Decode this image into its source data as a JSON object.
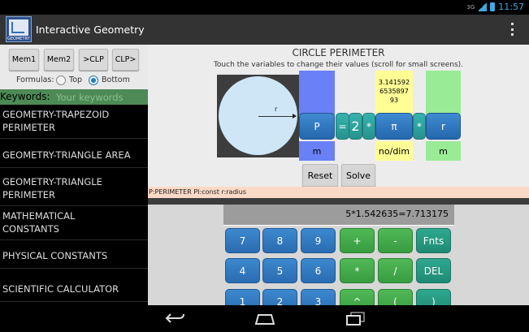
{
  "status_bar": {
    "network": "3G",
    "time": "11:57"
  },
  "app": {
    "title": "Interactive Geometry",
    "icon_label": "GEOMETRY"
  },
  "left": {
    "buttons": [
      "Mem1",
      "Mem2",
      ">CLP",
      "CLP>"
    ],
    "formulas_label": "Formulas:",
    "radio_top": "Top",
    "radio_bottom": "Bottom",
    "radio_selected": "Bottom",
    "keywords_label": "Keywords:",
    "keywords_placeholder": "Your keywords",
    "items": [
      [
        "GEOMETRY-TRAPEZOID",
        "PERIMETER"
      ],
      [
        "GEOMETRY-TRIANGLE AREA"
      ],
      [
        "GEOMETRY-TRIANGLE",
        "PERIMETER"
      ],
      [
        "MATHEMATICAL",
        "CONSTANTS"
      ],
      [
        "PHYSICAL CONSTANTS"
      ],
      [
        "SCIENTIFIC CALCULATOR"
      ]
    ]
  },
  "formula": {
    "title": "CIRCLE PERIMETER",
    "instructions": "Touch the variables to change their values (scroll for small screens).",
    "diagram_radius_label": "r",
    "variables": {
      "P": {
        "label": "P",
        "value": "",
        "unit": "m",
        "color": "#6a80f7"
      },
      "pi": {
        "label": "π",
        "value": [
          "3.141592",
          "6535897",
          "93"
        ],
        "unit": "no/dim",
        "color": "#fffe94"
      },
      "r": {
        "label": "r",
        "value": "",
        "unit": "m",
        "color": "#99eb96"
      }
    },
    "operators": {
      "eq": "=",
      "two": "2",
      "mul": "*"
    },
    "reset_label": "Reset",
    "solve_label": "Solve",
    "legend": "P:PERIMETER  PI:const  r:radius"
  },
  "calculator": {
    "display": "5*1.542635=7.713175",
    "rows": [
      [
        {
          "label": "7",
          "kind": "num"
        },
        {
          "label": "8",
          "kind": "num"
        },
        {
          "label": "9",
          "kind": "num"
        },
        {
          "label": "+",
          "kind": "op"
        },
        {
          "label": "-",
          "kind": "op"
        },
        {
          "label": "Fnts",
          "kind": "fn"
        }
      ],
      [
        {
          "label": "4",
          "kind": "num"
        },
        {
          "label": "5",
          "kind": "num"
        },
        {
          "label": "6",
          "kind": "num"
        },
        {
          "label": "*",
          "kind": "op"
        },
        {
          "label": "/",
          "kind": "op"
        },
        {
          "label": "DEL",
          "kind": "fn"
        }
      ],
      [
        {
          "label": "1",
          "kind": "num"
        },
        {
          "label": "2",
          "kind": "num"
        },
        {
          "label": "3",
          "kind": "num"
        },
        {
          "label": "^",
          "kind": "op"
        },
        {
          "label": "(",
          "kind": "op"
        },
        {
          "label": ")",
          "kind": "fn"
        }
      ]
    ]
  },
  "nav": {
    "icons": [
      "back-icon",
      "home-icon",
      "recent-apps-icon"
    ]
  }
}
